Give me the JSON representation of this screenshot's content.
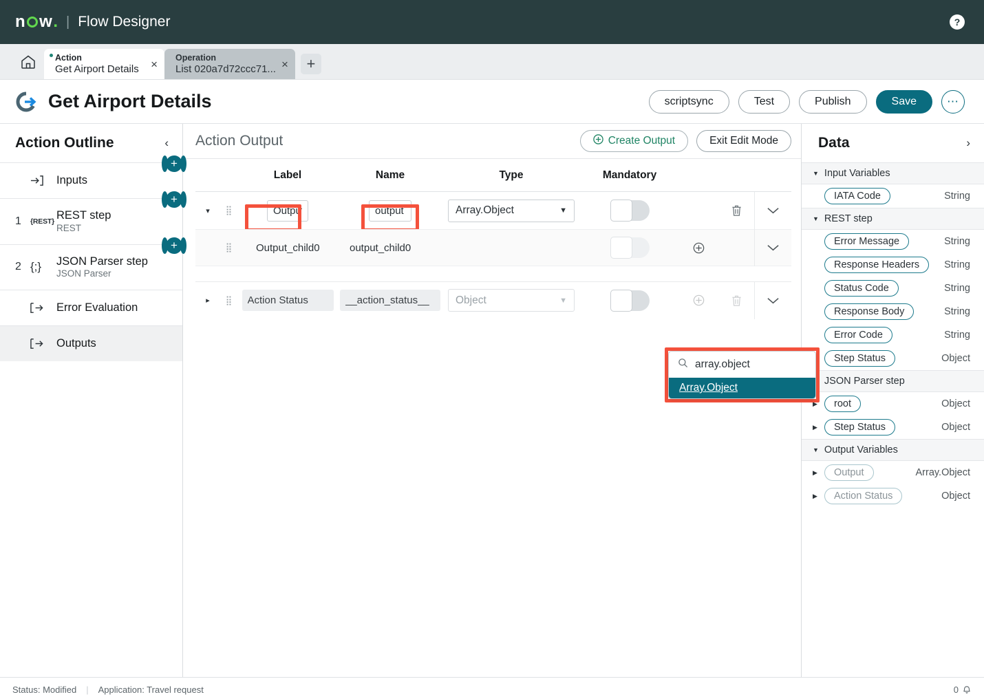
{
  "topnav": {
    "brand": "now",
    "brand_dot": ".",
    "pipe": "|",
    "app_name": "Flow Designer",
    "help_label": "?"
  },
  "tabs": {
    "home_icon": "home-icon",
    "items": [
      {
        "kind": "Action",
        "title": "Get Airport Details",
        "close": "×",
        "active": true
      },
      {
        "kind": "Operation",
        "title": "List 020a7d72ccc71...",
        "close": "×",
        "active": false
      }
    ],
    "add_label": "+"
  },
  "title_bar": {
    "title": "Get Airport Details",
    "buttons": [
      {
        "label": "scriptsync",
        "style": "ghost"
      },
      {
        "label": "Test",
        "style": "ghost"
      },
      {
        "label": "Publish",
        "style": "ghost"
      },
      {
        "label": "Save",
        "style": "primary"
      }
    ],
    "more_label": "⋯"
  },
  "outline": {
    "title": "Action Outline",
    "collapse_icon": "‹",
    "items": [
      {
        "num": "",
        "icon": "enter-arrow-icon",
        "label": "Inputs",
        "sub": "",
        "selected": false,
        "plus": true
      },
      {
        "num": "1",
        "icon": "{REST}",
        "label": "REST step",
        "sub": "REST",
        "selected": false,
        "plus": true
      },
      {
        "num": "2",
        "icon": "{;}",
        "label": "JSON Parser step",
        "sub": "JSON Parser",
        "selected": false,
        "plus": true
      },
      {
        "num": "",
        "icon": "exit-arrow-icon",
        "label": "Error Evaluation",
        "sub": "",
        "selected": false,
        "plus": false
      },
      {
        "num": "",
        "icon": "exit-arrow-icon",
        "label": "Outputs",
        "sub": "",
        "selected": true,
        "plus": false
      }
    ]
  },
  "main": {
    "header": "Action Output",
    "create_output_label": "Create Output",
    "exit_edit_label": "Exit Edit Mode",
    "columns": [
      "Label",
      "Name",
      "Type",
      "Mandatory"
    ],
    "rows": [
      {
        "label": "Output",
        "name": "output",
        "type": "Array.Object",
        "mandatory": false,
        "highlighted": true,
        "expanded": true,
        "caret": "▾",
        "can_add": false,
        "can_delete": true
      },
      {
        "label": "Output_child0",
        "name": "output_child0",
        "type": "",
        "mandatory": false,
        "highlighted": false,
        "child": true,
        "can_add": true,
        "can_delete": false
      },
      {
        "label": "Action Status",
        "name": "__action_status__",
        "type": "Object",
        "mandatory": false,
        "readonly": true,
        "caret": "▸",
        "can_add": true,
        "can_delete": true
      }
    ],
    "dropdown": {
      "search_value": "array.object",
      "search_icon": "search-icon",
      "options": [
        "Array.Object"
      ],
      "selected": "Array.Object"
    }
  },
  "data_panel": {
    "title": "Data",
    "expand_icon": "›",
    "groups": [
      {
        "name": "Input Variables",
        "items": [
          {
            "label": "IATA Code",
            "type": "String",
            "expandable": false,
            "dim": false
          }
        ]
      },
      {
        "name": "REST step",
        "items": [
          {
            "label": "Error Message",
            "type": "String",
            "expandable": false,
            "dim": false
          },
          {
            "label": "Response Headers",
            "type": "String",
            "expandable": false,
            "dim": false
          },
          {
            "label": "Status Code",
            "type": "String",
            "expandable": false,
            "dim": false
          },
          {
            "label": "Response Body",
            "type": "String",
            "expandable": false,
            "dim": false
          },
          {
            "label": "Error Code",
            "type": "String",
            "expandable": false,
            "dim": false
          },
          {
            "label": "Step Status",
            "type": "Object",
            "expandable": true,
            "dim": false
          }
        ]
      },
      {
        "name": "JSON Parser step",
        "items": [
          {
            "label": "root",
            "type": "Object",
            "expandable": true,
            "dim": false
          },
          {
            "label": "Step Status",
            "type": "Object",
            "expandable": true,
            "dim": false
          }
        ]
      },
      {
        "name": "Output Variables",
        "items": [
          {
            "label": "Output",
            "type": "Array.Object",
            "expandable": true,
            "dim": true
          },
          {
            "label": "Action Status",
            "type": "Object",
            "expandable": true,
            "dim": true
          }
        ]
      }
    ]
  },
  "status_bar": {
    "status": "Status: Modified",
    "application": "Application: Travel request",
    "notification_count": "0",
    "bell_icon": "bell-icon"
  },
  "colors": {
    "nav_bg": "#293e40",
    "teal": "#0a6c7f",
    "green": "#1f8464",
    "highlight_red": "#f4513c",
    "tab_inactive": "#bdc4c8"
  }
}
